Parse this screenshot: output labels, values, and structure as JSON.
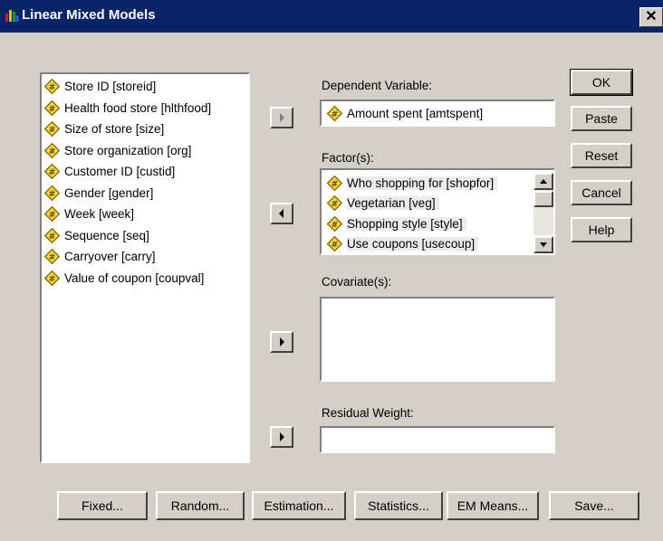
{
  "window": {
    "title": "Linear Mixed Models",
    "close_glyph": "✕"
  },
  "source_variables": [
    {
      "label": "Store ID [storeid]",
      "icon": "scale-variable-icon"
    },
    {
      "label": "Health food store [hlthfood]",
      "icon": "scale-variable-icon"
    },
    {
      "label": "Size of store [size]",
      "icon": "scale-variable-icon"
    },
    {
      "label": "Store organization [org]",
      "icon": "scale-variable-icon"
    },
    {
      "label": "Customer ID [custid]",
      "icon": "scale-variable-icon"
    },
    {
      "label": "Gender [gender]",
      "icon": "scale-variable-icon"
    },
    {
      "label": "Week [week]",
      "icon": "scale-variable-icon"
    },
    {
      "label": "Sequence [seq]",
      "icon": "scale-variable-icon"
    },
    {
      "label": "Carryover [carry]",
      "icon": "scale-variable-icon"
    },
    {
      "label": "Value of coupon [coupval]",
      "icon": "scale-variable-icon"
    }
  ],
  "dependent": {
    "label": "Dependent Variable:",
    "value": "Amount spent [amtspent]"
  },
  "factors": {
    "label": "Factor(s):",
    "items": [
      "Who shopping for [shopfor]",
      "Vegetarian [veg]",
      "Shopping style [style]",
      "Use coupons [usecoup]"
    ]
  },
  "covariates": {
    "label": "Covariate(s):"
  },
  "residual_weight": {
    "label": "Residual Weight:",
    "value": ""
  },
  "side_buttons": {
    "ok": "OK",
    "paste": "Paste",
    "reset": "Reset",
    "cancel": "Cancel",
    "help": "Help"
  },
  "bottom_buttons": {
    "fixed": "Fixed...",
    "random": "Random...",
    "estimation": "Estimation...",
    "statistics": "Statistics...",
    "em_means": "EM Means...",
    "save": "Save..."
  },
  "colors": {
    "titlebar": "#0a246a",
    "face": "#d4d0c8",
    "icon_yellow": "#e8c800"
  }
}
